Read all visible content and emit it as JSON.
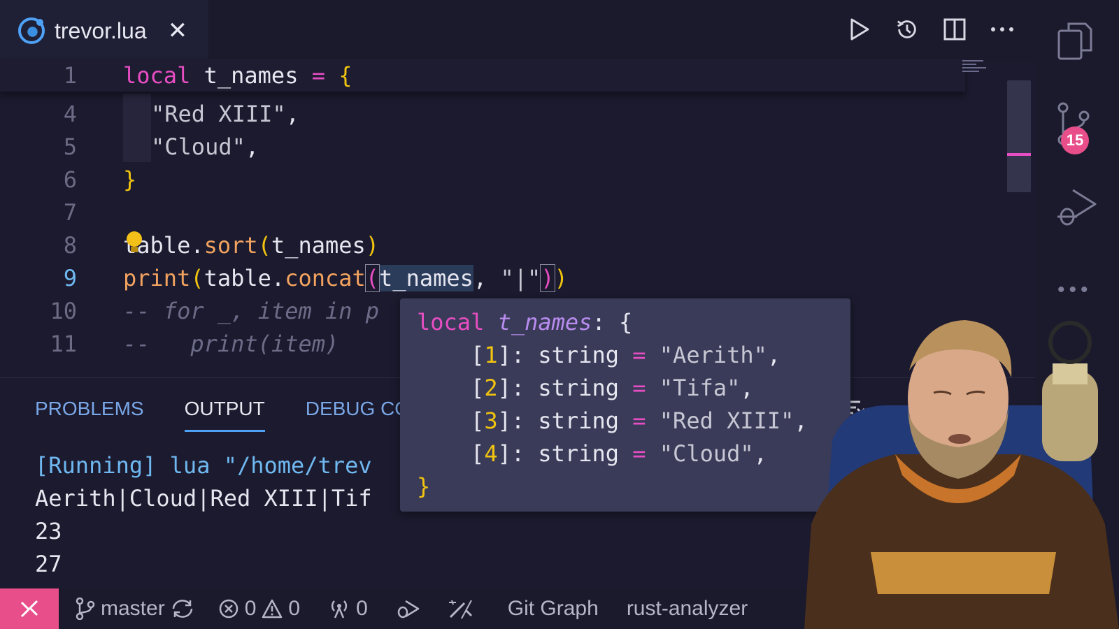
{
  "tab": {
    "title": "trevor.lua",
    "close": "✕"
  },
  "editor": {
    "line_numbers": [
      "1",
      "4",
      "5",
      "6",
      "7",
      "8",
      "9",
      "10",
      "11"
    ],
    "lines": {
      "l1": {
        "kw": "local",
        "id": " t_names ",
        "op": "=",
        "br": " {"
      },
      "l4": {
        "str": "\"Red XIII\"",
        "tail": ","
      },
      "l5": {
        "str": "\"Cloud\"",
        "tail": ","
      },
      "l6": {
        "br": "}"
      },
      "l8": {
        "a": "table",
        "b": ".",
        "c": "sort",
        "d": "(",
        "e": "t_names",
        "f": ")"
      },
      "l9": {
        "a": "print",
        "b": "(",
        "c": "table",
        "d": ".",
        "e": "concat",
        "f": "(",
        "g": "t_names",
        "h": ", ",
        "i": "\"|\"",
        "j": ")",
        "k": ")"
      },
      "l10": "-- for _, item in p",
      "l11": "--   print(item)"
    }
  },
  "hover": {
    "kw": "local",
    "name": "t_names",
    "sep": ": {",
    "entries": [
      {
        "idx": "1",
        "type": "string",
        "val": "\"Aerith\""
      },
      {
        "idx": "2",
        "type": "string",
        "val": "\"Tifa\""
      },
      {
        "idx": "3",
        "type": "string",
        "val": "\"Red XIII\""
      },
      {
        "idx": "4",
        "type": "string",
        "val": "\"Cloud\""
      }
    ],
    "close": "}"
  },
  "panel": {
    "tabs": [
      "PROBLEMS",
      "OUTPUT",
      "DEBUG CON"
    ],
    "active_tab": "OUTPUT",
    "output": [
      "[Running] lua \"/home/trev",
      "Aerith|Cloud|Red XIII|Tif",
      "23",
      "27"
    ]
  },
  "activity": {
    "badge": "15"
  },
  "status": {
    "branch": "master",
    "errors": "0",
    "warnings": "0",
    "ports": "0",
    "git_graph": "Git Graph",
    "rust_analyzer": "rust-analyzer"
  },
  "colors": {
    "accent": "#e84e89",
    "keyword": "#e84ec3",
    "bracket": "#f1c40f",
    "function": "#f08a3e"
  }
}
